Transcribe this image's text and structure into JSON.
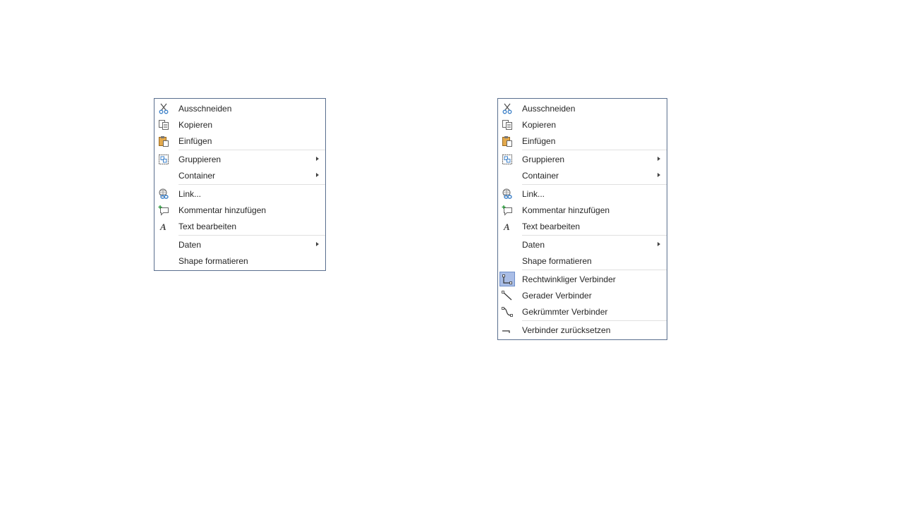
{
  "menu_left": {
    "items": [
      {
        "label": "Ausschneiden",
        "icon": "scissors-icon"
      },
      {
        "label": "Kopieren",
        "icon": "copy-icon"
      },
      {
        "label": "Einfügen",
        "icon": "paste-icon"
      },
      {
        "label": "Gruppieren",
        "icon": "group-icon",
        "submenu": true
      },
      {
        "label": "Container",
        "submenu": true
      },
      {
        "label": "Link...",
        "icon": "link-icon"
      },
      {
        "label": "Kommentar hinzufügen",
        "icon": "comment-icon"
      },
      {
        "label": "Text bearbeiten",
        "icon": "text-icon"
      },
      {
        "label": "Daten",
        "submenu": true
      },
      {
        "label": "Shape formatieren"
      }
    ]
  },
  "menu_right": {
    "items": [
      {
        "label": "Ausschneiden",
        "icon": "scissors-icon"
      },
      {
        "label": "Kopieren",
        "icon": "copy-icon"
      },
      {
        "label": "Einfügen",
        "icon": "paste-icon"
      },
      {
        "label": "Gruppieren",
        "icon": "group-icon",
        "submenu": true
      },
      {
        "label": "Container",
        "submenu": true
      },
      {
        "label": "Link...",
        "icon": "link-icon"
      },
      {
        "label": "Kommentar hinzufügen",
        "icon": "comment-icon"
      },
      {
        "label": "Text bearbeiten",
        "icon": "text-icon"
      },
      {
        "label": "Daten",
        "submenu": true
      },
      {
        "label": "Shape formatieren"
      },
      {
        "label": "Rechtwinkliger Verbinder",
        "icon": "right-angle-connector-icon",
        "checked": true
      },
      {
        "label": "Gerader Verbinder",
        "icon": "straight-connector-icon"
      },
      {
        "label": "Gekrümmter Verbinder",
        "icon": "curved-connector-icon"
      },
      {
        "label": "Verbinder zurücksetzen",
        "icon": "reset-connector-icon"
      }
    ]
  },
  "colors": {
    "menu_border": "#5a6f8e",
    "checked_background": "#a9bde6",
    "separator": "#e0e0e0"
  }
}
